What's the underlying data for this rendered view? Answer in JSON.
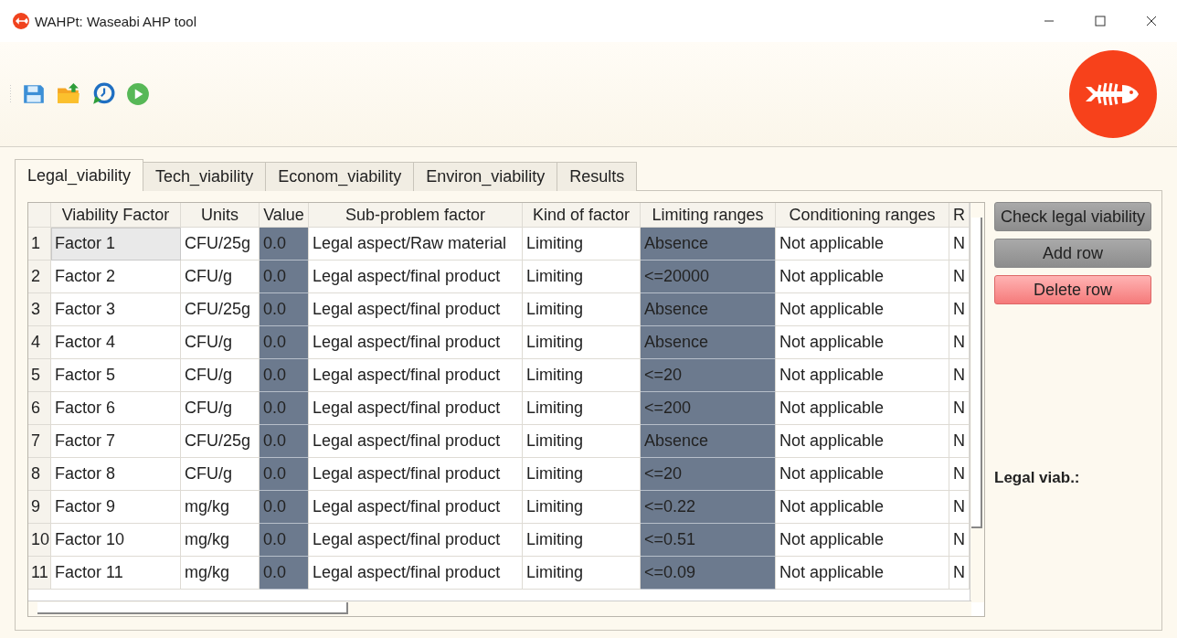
{
  "window": {
    "title": "WAHPt: Waseabi AHP tool"
  },
  "tabs": [
    {
      "label": "Legal_viability",
      "selected": true
    },
    {
      "label": "Tech_viability",
      "selected": false
    },
    {
      "label": "Econom_viability",
      "selected": false
    },
    {
      "label": "Environ_viability",
      "selected": false
    },
    {
      "label": "Results",
      "selected": false
    }
  ],
  "table": {
    "columns": [
      {
        "label": "Viability Factor",
        "shaded": false
      },
      {
        "label": "Units",
        "shaded": false
      },
      {
        "label": "Value",
        "shaded": true
      },
      {
        "label": "Sub-problem factor",
        "shaded": false
      },
      {
        "label": "Kind of factor",
        "shaded": false
      },
      {
        "label": "Limiting ranges",
        "shaded": true
      },
      {
        "label": "Conditioning ranges",
        "shaded": false
      },
      {
        "label": "R",
        "shaded": false
      }
    ],
    "rows": [
      {
        "number": "1",
        "selected": true,
        "cells": [
          "Factor 1",
          "CFU/25g",
          "0.0",
          "Legal aspect/Raw material",
          "Limiting",
          "Absence",
          "Not applicable",
          "N"
        ]
      },
      {
        "number": "2",
        "selected": false,
        "cells": [
          "Factor 2",
          "CFU/g",
          "0.0",
          "Legal aspect/final product",
          "Limiting",
          "<=20000",
          "Not applicable",
          "N"
        ]
      },
      {
        "number": "3",
        "selected": false,
        "cells": [
          "Factor 3",
          "CFU/25g",
          "0.0",
          "Legal aspect/final product",
          "Limiting",
          "Absence",
          "Not applicable",
          "N"
        ]
      },
      {
        "number": "4",
        "selected": false,
        "cells": [
          "Factor 4",
          "CFU/g",
          "0.0",
          "Legal aspect/final product",
          "Limiting",
          "Absence",
          "Not applicable",
          "N"
        ]
      },
      {
        "number": "5",
        "selected": false,
        "cells": [
          "Factor 5",
          "CFU/g",
          "0.0",
          "Legal aspect/final product",
          "Limiting",
          "<=20",
          "Not applicable",
          "N"
        ]
      },
      {
        "number": "6",
        "selected": false,
        "cells": [
          "Factor 6",
          "CFU/g",
          "0.0",
          "Legal aspect/final product",
          "Limiting",
          "<=200",
          "Not applicable",
          "N"
        ]
      },
      {
        "number": "7",
        "selected": false,
        "cells": [
          "Factor 7",
          "CFU/25g",
          "0.0",
          "Legal aspect/final product",
          "Limiting",
          "Absence",
          "Not applicable",
          "N"
        ]
      },
      {
        "number": "8",
        "selected": false,
        "cells": [
          "Factor 8",
          "CFU/g",
          "0.0",
          "Legal aspect/final product",
          "Limiting",
          "<=20",
          "Not applicable",
          "N"
        ]
      },
      {
        "number": "9",
        "selected": false,
        "cells": [
          "Factor 9",
          "mg/kg",
          "0.0",
          "Legal aspect/final product",
          "Limiting",
          "<=0.22",
          "Not applicable",
          "N"
        ]
      },
      {
        "number": "10",
        "selected": false,
        "cells": [
          "Factor 10",
          "mg/kg",
          "0.0",
          "Legal aspect/final product",
          "Limiting",
          "<=0.51",
          "Not applicable",
          "N"
        ]
      },
      {
        "number": "11",
        "selected": false,
        "cells": [
          "Factor 11",
          "mg/kg",
          "0.0",
          "Legal aspect/final product",
          "Limiting",
          "<=0.09",
          "Not applicable",
          "N"
        ]
      }
    ]
  },
  "buttons": [
    {
      "label": "Check legal viability",
      "kind": "neutral"
    },
    {
      "label": "Add row",
      "kind": "neutral"
    },
    {
      "label": "Delete row",
      "kind": "danger"
    }
  ],
  "result_label": "Legal viab.:"
}
